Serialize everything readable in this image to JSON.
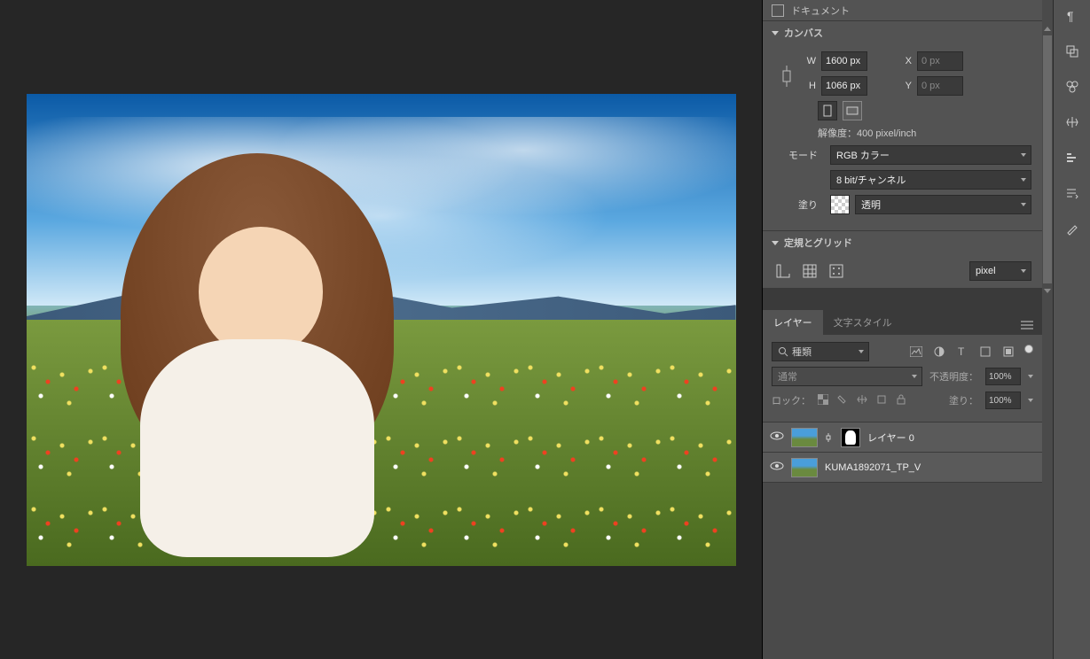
{
  "document": {
    "title": "ドキュメント"
  },
  "canvas_panel": {
    "title": "カンバス",
    "w_label": "W",
    "w_value": "1600 px",
    "h_label": "H",
    "h_value": "1066 px",
    "x_label": "X",
    "x_value": "0 px",
    "y_label": "Y",
    "y_value": "0 px",
    "resolution_text": "解像度：400 pixel/inch",
    "mode_label": "モード",
    "color_mode": "RGB カラー",
    "bit_depth": "8 bit/チャンネル",
    "fill_label": "塗り",
    "fill_value": "透明"
  },
  "rulers_panel": {
    "title": "定規とグリッド",
    "unit": "pixel"
  },
  "layers_panel": {
    "tab_layers": "レイヤー",
    "tab_text_styles": "文字スタイル",
    "filter_label": "種類",
    "blend_mode": "通常",
    "opacity_label": "不透明度：",
    "opacity_value": "100%",
    "lock_label": "ロック：",
    "fill_opacity_label": "塗り：",
    "fill_opacity_value": "100%",
    "layers": [
      {
        "name": "レイヤー 0",
        "has_mask": true
      },
      {
        "name": "KUMA1892071_TP_V",
        "has_mask": false
      }
    ]
  }
}
